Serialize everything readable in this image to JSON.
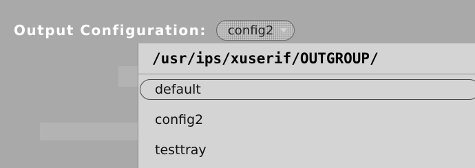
{
  "output_configuration": {
    "label": "Output Configuration:",
    "selected_value": "config2"
  },
  "menu": {
    "header_path": "/usr/ips/xuserif/OUTGROUP/",
    "items": [
      {
        "label": "default",
        "highlighted": true
      },
      {
        "label": "config2",
        "highlighted": false
      },
      {
        "label": "testtray",
        "highlighted": false
      }
    ]
  },
  "colors": {
    "background": "#a9a9a9",
    "menu_background": "#d4d4d4",
    "label_text": "#ffffff"
  }
}
